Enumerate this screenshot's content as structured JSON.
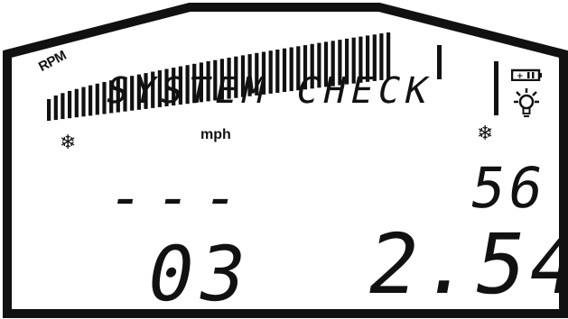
{
  "dashboard": {
    "rpm_label": "RPM",
    "message": "SYSTEM CHECK",
    "speed_unit": "mph",
    "top_left_value": "---",
    "gear_value": "03",
    "speed_value": "56",
    "lap_time_value": "2.54",
    "rpm_level": 0.84
  },
  "icons": {
    "left_indicator": "snowflake-icon",
    "right_indicator": "snowflake-icon",
    "battery": "battery-icon",
    "light": "light-bulb-icon"
  },
  "colors": {
    "segment": "#111111",
    "background": "#ffffff"
  }
}
